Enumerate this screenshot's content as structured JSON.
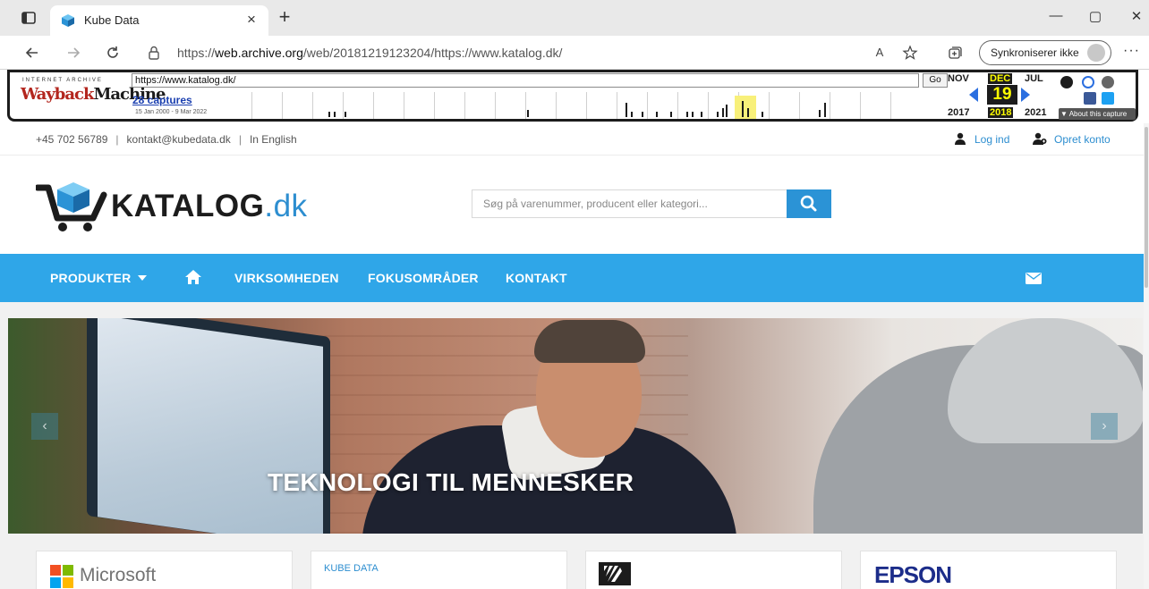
{
  "browser": {
    "tab_title": "Kube Data",
    "tab_close": "×",
    "new_tab": "+",
    "url_prefix": "https://",
    "url_host": "web.archive.org",
    "url_path": "/web/20181219123204/https://www.katalog.dk/",
    "read_aloud": "A",
    "sync_label": "Synkroniserer ikke",
    "more": "···",
    "minimize": "—",
    "restore": "▢",
    "close": "✕"
  },
  "wayback": {
    "logo_top": "INTERNET ARCHIVE",
    "logo_main": "Wayback",
    "logo_sub": "Machine",
    "url_value": "https://www.katalog.dk/",
    "go_label": "Go",
    "captures": "28 captures",
    "date_range": "15 Jan 2000 - 9 Mar 2022",
    "month_prev": "NOV",
    "month_cur": "DEC",
    "month_next": "JUL",
    "day": "19",
    "year_prev": "2017",
    "year_cur": "2018",
    "year_next": "2021",
    "about": "▼ About this capture"
  },
  "topline": {
    "phone": "+45 702 56789",
    "email": "kontakt@kubedata.dk",
    "language": "In English",
    "login": "Log ind",
    "signup": "Opret konto"
  },
  "header": {
    "logo_main": "KATALOG",
    "logo_tld": ".dk",
    "search_placeholder": "Søg på varenummer, producent eller kategori..."
  },
  "nav": {
    "products": "PRODUKTER",
    "company": "VIRKSOMHEDEN",
    "focus": "FOKUSOMRÅDER",
    "contact": "KONTAKT"
  },
  "hero": {
    "title": "TEKNOLOGI TIL MENNESKER",
    "prev": "‹",
    "next": "›"
  },
  "cards": {
    "microsoft": "Microsoft",
    "kube_label": "KUBE DATA",
    "epson": "EPSON"
  },
  "colors": {
    "accent": "#2fa6e8",
    "link": "#2d8ed0"
  }
}
